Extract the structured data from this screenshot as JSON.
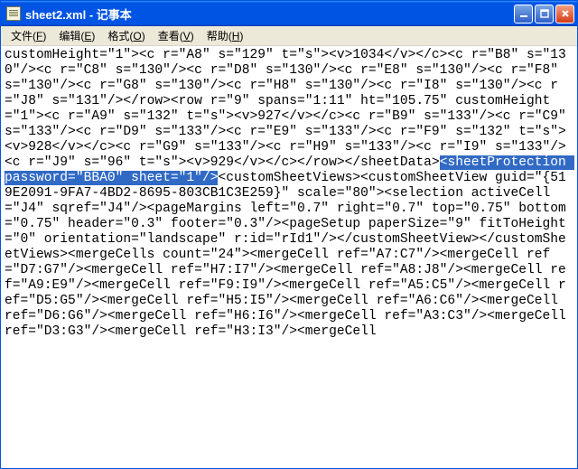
{
  "window": {
    "title": "sheet2.xml - 记事本"
  },
  "menu": {
    "file": {
      "label": "文件",
      "accel": "F"
    },
    "edit": {
      "label": "编辑",
      "accel": "E"
    },
    "format": {
      "label": "格式",
      "accel": "O"
    },
    "view": {
      "label": "查看",
      "accel": "V"
    },
    "help": {
      "label": "帮助",
      "accel": "H"
    }
  },
  "content": {
    "before_selection": "customHeight=\"1\"><c r=\"A8\" s=\"129\" t=\"s\"><v>1034</v></c><c r=\"B8\" s=\"130\"/><c r=\"C8\" s=\"130\"/><c r=\"D8\" s=\"130\"/><c r=\"E8\" s=\"130\"/><c r=\"F8\" s=\"130\"/><c r=\"G8\" s=\"130\"/><c r=\"H8\" s=\"130\"/><c r=\"I8\" s=\"130\"/><c r=\"J8\" s=\"131\"/></row><row r=\"9\" spans=\"1:11\" ht=\"105.75\" customHeight=\"1\"><c r=\"A9\" s=\"132\" t=\"s\"><v>927</v></c><c r=\"B9\" s=\"133\"/><c r=\"C9\" s=\"133\"/><c r=\"D9\" s=\"133\"/><c r=\"E9\" s=\"133\"/><c r=\"F9\" s=\"132\" t=\"s\"><v>928</v></c><c r=\"G9\" s=\"133\"/><c r=\"H9\" s=\"133\"/><c r=\"I9\" s=\"133\"/><c r=\"J9\" s=\"96\" t=\"s\"><v>929</v></c></row></sheetData>",
    "selection": "<sheetProtection password=\"BBA0\" sheet=\"1\"/>",
    "after_selection": "<customSheetViews><customSheetView guid=\"{519E2091-9FA7-4BD2-8695-803CB1C3E259}\" scale=\"80\"><selection activeCell=\"J4\" sqref=\"J4\"/><pageMargins left=\"0.7\" right=\"0.7\" top=\"0.75\" bottom=\"0.75\" header=\"0.3\" footer=\"0.3\"/><pageSetup paperSize=\"9\" fitToHeight=\"0\" orientation=\"landscape\" r:id=\"rId1\"/></customSheetView></customSheetViews><mergeCells count=\"24\"><mergeCell ref=\"A7:C7\"/><mergeCell ref=\"D7:G7\"/><mergeCell ref=\"H7:I7\"/><mergeCell ref=\"A8:J8\"/><mergeCell ref=\"A9:E9\"/><mergeCell ref=\"F9:I9\"/><mergeCell ref=\"A5:C5\"/><mergeCell ref=\"D5:G5\"/><mergeCell ref=\"H5:I5\"/><mergeCell ref=\"A6:C6\"/><mergeCell ref=\"D6:G6\"/><mergeCell ref=\"H6:I6\"/><mergeCell ref=\"A3:C3\"/><mergeCell ref=\"D3:G3\"/><mergeCell ref=\"H3:I3\"/><mergeCell"
  }
}
